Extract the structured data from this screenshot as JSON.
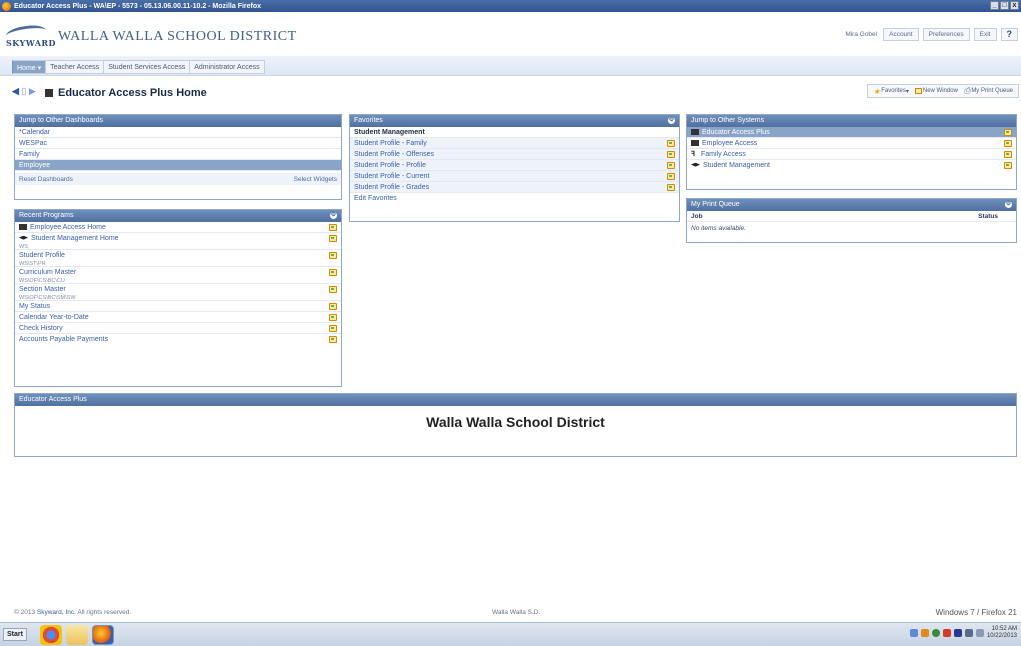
{
  "window": {
    "title": "Educator Access Plus - WA\\EP - 5573 - 05.13.06.00.11-10.2 - Mozilla Firefox",
    "controls": [
      "_",
      "□",
      "x"
    ]
  },
  "header": {
    "logo_text": "SKYWARD",
    "district_name": "WALLA WALLA SCHOOL DISTRICT",
    "user_name": "Mira Gobel",
    "account": "Account",
    "preferences": "Preferences",
    "exit": "Exit",
    "help": "?"
  },
  "nav": {
    "home": "Home",
    "dropdown_icon": "▾",
    "tabs": [
      "Teacher Access",
      "Student Services Access",
      "Administrator Access"
    ]
  },
  "page": {
    "title": "Educator Access Plus Home",
    "favorites": "Favorites",
    "favorites_caret": "▾",
    "new_window": "New Window",
    "my_print_queue": "My Print Queue"
  },
  "dashboards": {
    "title": "Jump to Other Dashboards",
    "items": [
      "*Calendar",
      "WESPac",
      "Family",
      "Employee"
    ],
    "selected": "Employee",
    "reset": "Reset Dashboards",
    "select_widgets": "Select Widgets"
  },
  "recent": {
    "title": "Recent Programs",
    "gear": "⚙",
    "items": [
      {
        "label": "Employee Access Home",
        "sub": ""
      },
      {
        "label": "Student Management Home",
        "sub": "WS"
      },
      {
        "label": "Student Profile",
        "sub": "WS\\ST\\PR"
      },
      {
        "label": "Curriculum Master",
        "sub": "WS\\OF\\CS\\BC\\CU"
      },
      {
        "label": "Section Master",
        "sub": "WS\\OF\\CS\\BC\\SM\\SW"
      },
      {
        "label": "My Status",
        "sub": ""
      },
      {
        "label": "Calendar Year-to-Date",
        "sub": ""
      },
      {
        "label": "Check History",
        "sub": ""
      },
      {
        "label": "Accounts Payable Payments",
        "sub": ""
      }
    ]
  },
  "favorites": {
    "title": "Favorites",
    "gear": "⚙",
    "group": "Student Management",
    "items": [
      "Student Profile - Family",
      "Student Profile - Offenses",
      "Student Profile - Profile",
      "Student Profile - Current",
      "Student Profile - Grades"
    ],
    "edit": "Edit Favorites"
  },
  "systems": {
    "title": "Jump to Other Systems",
    "items": [
      "Educator Access Plus",
      "Employee Access",
      "Family Access",
      "Student Management"
    ],
    "selected": "Educator Access Plus"
  },
  "printqueue": {
    "title": "My Print Queue",
    "gear": "⚙",
    "col_job": "Job",
    "col_status": "Status",
    "empty": "No items available."
  },
  "eap": {
    "title": "Educator Access Plus",
    "heading": "Walla Walla School District"
  },
  "footer": {
    "copyright_prefix": "© 2013",
    "company": "Skyward, Inc.",
    "rights": "All rights reserved.",
    "center": "Walla Walla S.D.",
    "right": "Windows 7 / Firefox 21"
  },
  "taskbar": {
    "start": "Start",
    "time": "10:52 AM",
    "date": "10/22/2013"
  },
  "colors": {
    "panel_header": "#5a7aaa",
    "selected_row": "#8aa4c8",
    "link": "#3a5ea8"
  }
}
